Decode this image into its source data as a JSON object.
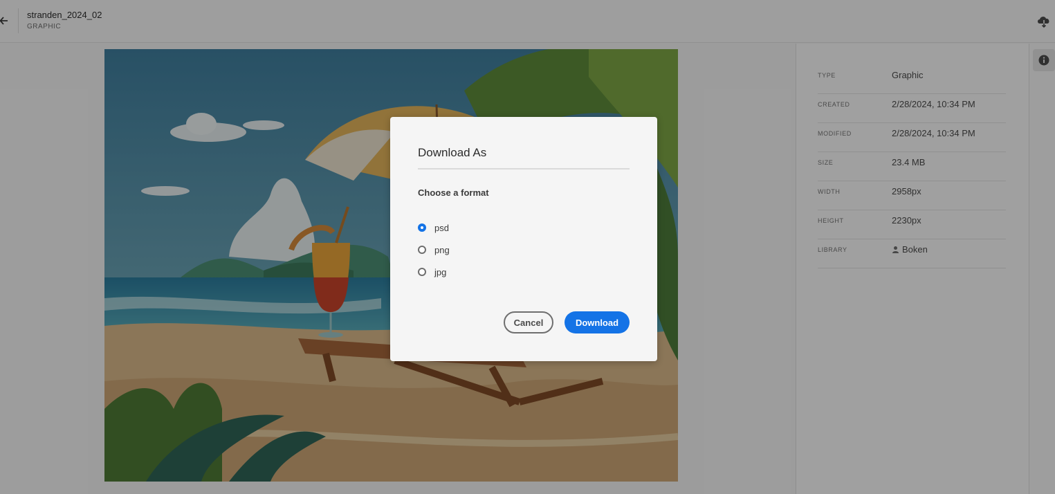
{
  "header": {
    "file_name": "stranden_2024_02",
    "file_type": "GRAPHIC",
    "back_icon": "arrow-left-icon",
    "download_icon": "cloud-download-icon"
  },
  "details": {
    "rows": [
      {
        "key": "TYPE",
        "value": "Graphic"
      },
      {
        "key": "CREATED",
        "value": "2/28/2024, 10:34 PM"
      },
      {
        "key": "MODIFIED",
        "value": "2/28/2024, 10:34 PM"
      },
      {
        "key": "SIZE",
        "value": "23.4 MB"
      },
      {
        "key": "WIDTH",
        "value": "2958px"
      },
      {
        "key": "HEIGHT",
        "value": "2230px"
      },
      {
        "key": "LIBRARY",
        "value": "Boken"
      }
    ],
    "library_icon": "user-icon",
    "info_icon": "info-icon"
  },
  "dialog": {
    "title": "Download As",
    "subtitle": "Choose a format",
    "options": [
      {
        "label": "psd",
        "checked": true
      },
      {
        "label": "png",
        "checked": false
      },
      {
        "label": "jpg",
        "checked": false
      }
    ],
    "cancel_label": "Cancel",
    "download_label": "Download"
  },
  "colors": {
    "accent": "#1473e6",
    "overlay": "rgba(0,0,0,0.36)"
  }
}
